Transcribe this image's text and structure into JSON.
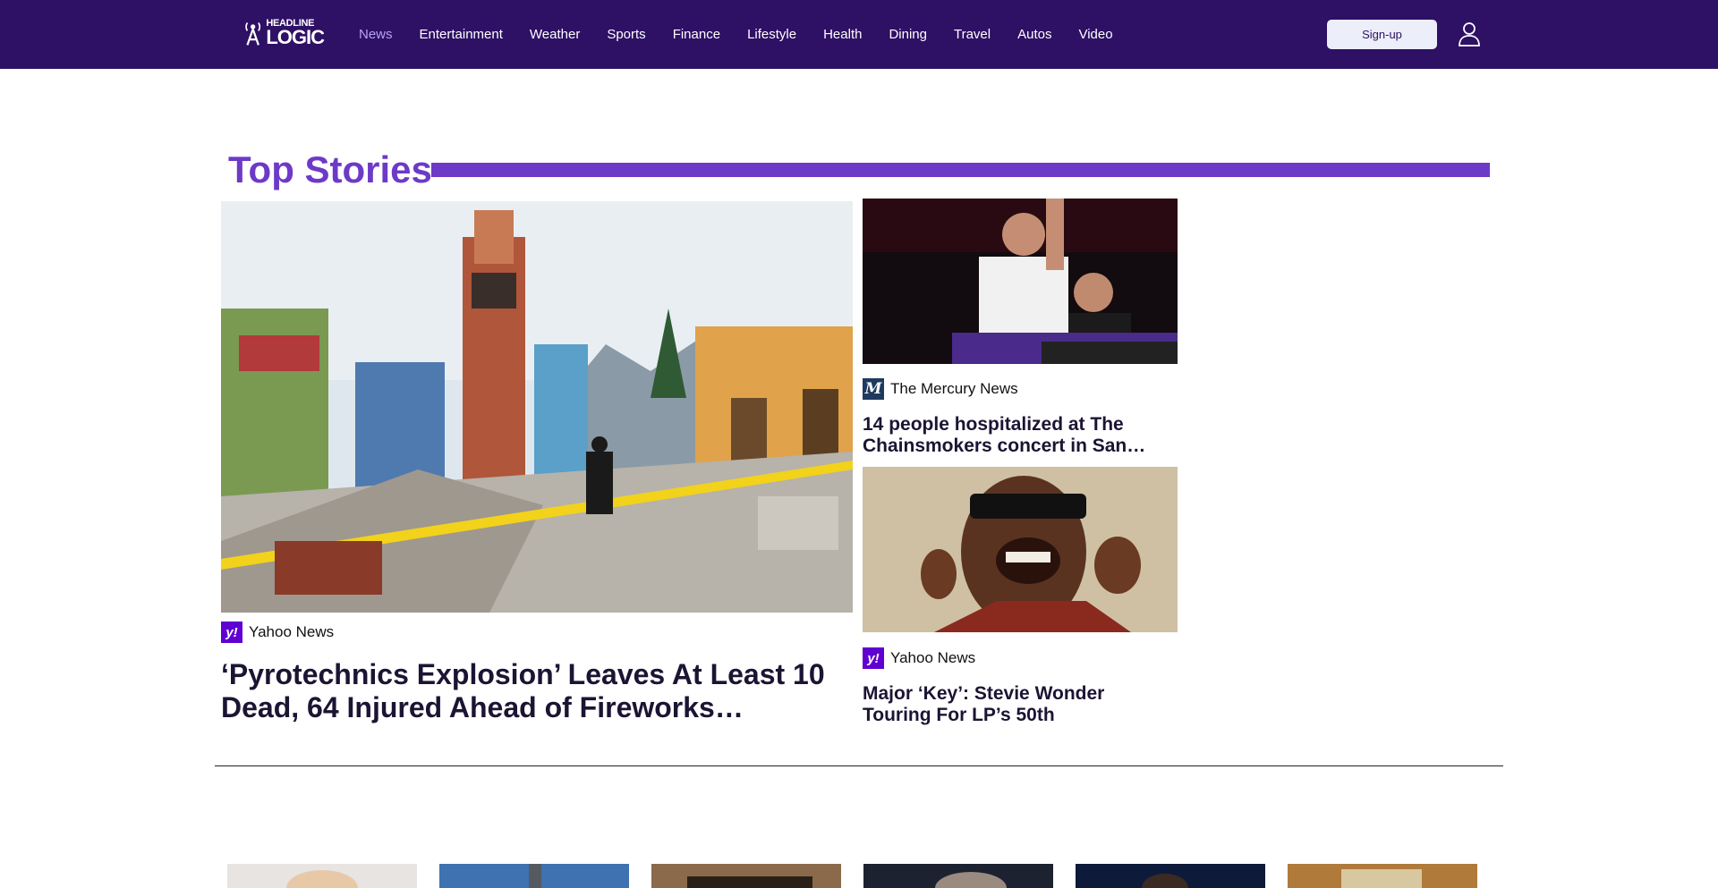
{
  "brand": {
    "logo_top": "HEADLINE",
    "logo_bottom": "LOGIC"
  },
  "nav": {
    "items": [
      {
        "label": "News",
        "active": true
      },
      {
        "label": "Entertainment",
        "active": false
      },
      {
        "label": "Weather",
        "active": false
      },
      {
        "label": "Sports",
        "active": false
      },
      {
        "label": "Finance",
        "active": false
      },
      {
        "label": "Lifestyle",
        "active": false
      },
      {
        "label": "Health",
        "active": false
      },
      {
        "label": "Dining",
        "active": false
      },
      {
        "label": "Travel",
        "active": false
      },
      {
        "label": "Autos",
        "active": false
      },
      {
        "label": "Video",
        "active": false
      }
    ],
    "signup_label": "Sign-up",
    "user_icon": "user-icon"
  },
  "top_stories": {
    "title": "Top Stories",
    "main": {
      "source": "Yahoo News",
      "source_logo": "y!",
      "headline": "‘Pyrotechnics Explosion’ Leaves At Least 10 Dead, 64 Injured Ahead of Fireworks…"
    },
    "side": [
      {
        "source": "The Mercury News",
        "source_logo": "M",
        "headline": "14 people hospitalized at The Chainsmokers concert in San…"
      },
      {
        "source": "Yahoo News",
        "source_logo": "y!",
        "headline": "Major ‘Key’: Stevie Wonder Touring For LP’s 50th"
      }
    ]
  },
  "colors": {
    "nav_bg": "#2e1065",
    "accent": "#6d3ac7",
    "nav_active": "#b8a3f0",
    "yahoo_purple": "#6001d2"
  }
}
